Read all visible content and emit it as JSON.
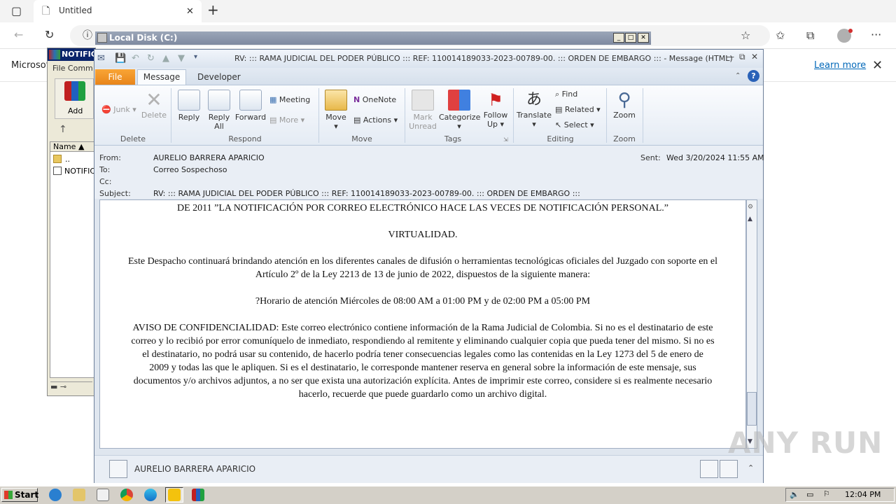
{
  "browser": {
    "tab_title": "Untitled",
    "banner_text": "Microsof",
    "learn_more": "Learn more"
  },
  "winrar": {
    "title": "NOTIFIC",
    "menu": "File  Comm",
    "add_label": "Add",
    "column_name": "Name",
    "rows": [
      "..",
      "NOTIFIC"
    ]
  },
  "explorer": {
    "title": "Local Disk (C:)"
  },
  "outlook": {
    "window_title": "RV: ::: RAMA JUDICIAL DEL PODER PÚBLICO ::: REF: 110014189033-2023-00789-00. ::: ORDEN DE EMBARGO ::: -  Message (HTML)",
    "tabs": {
      "file": "File",
      "message": "Message",
      "developer": "Developer"
    },
    "ribbon": {
      "delete_group": {
        "label": "Delete",
        "junk": "Junk",
        "delete": "Delete"
      },
      "respond_group": {
        "label": "Respond",
        "reply": "Reply",
        "reply_all_1": "Reply",
        "reply_all_2": "All",
        "forward": "Forward",
        "meeting": "Meeting",
        "more": "More"
      },
      "move_group": {
        "label": "Move",
        "move": "Move",
        "onenote": "OneNote",
        "actions": "Actions"
      },
      "tags_group": {
        "label": "Tags",
        "mark_1": "Mark",
        "mark_2": "Unread",
        "categorize": "Categorize",
        "follow_1": "Follow",
        "follow_2": "Up"
      },
      "editing_group": {
        "label": "Editing",
        "translate": "Translate",
        "find": "Find",
        "related": "Related",
        "select": "Select"
      },
      "zoom_group": {
        "label": "Zoom",
        "zoom": "Zoom"
      }
    },
    "header": {
      "from_label": "From:",
      "from_value": "AURELIO  BARRERA APARICIO",
      "to_label": "To:",
      "to_value": "Correo Sospechoso",
      "cc_label": "Cc:",
      "subject_label": "Subject:",
      "subject_value": "RV: ::: RAMA JUDICIAL DEL PODER PÚBLICO ::: REF: 110014189033-2023-00789-00. ::: ORDEN DE EMBARGO :::",
      "sent_label": "Sent:",
      "sent_value": "Wed 3/20/2024 11:55 AM"
    },
    "body": {
      "line1": "DE 2011 ”LA NOTIFICACIÓN POR CORREO ELECTRÓNICO HACE LAS VECES DE NOTIFICACIÓN PERSONAL.”",
      "line2": "VIRTUALIDAD.",
      "para1_l1": "Este Despacho continuará brindando atención en los diferentes canales de difusión o herramientas tecnológicas oficiales del Juzgado con soporte en el",
      "para1_l2": "Artículo 2º de la Ley 2213 de 13 de junio de 2022, dispuestos de la siguiente manera:",
      "hours": "?Horario de atención Miércoles de 08:00 AM a 01:00 PM y de 02:00 PM a 05:00 PM",
      "conf_l1": "AVISO DE CONFIDENCIALIDAD: Este correo electrónico contiene información de la Rama Judicial de Colombia. Si no es el destinatario de este",
      "conf_l2": "correo y lo recibió por error comuníquelo de inmediato, respondiendo al remitente y eliminando cualquier copia que pueda tener del mismo. Si no es",
      "conf_l3": "el destinatario, no podrá usar su contenido, de hacerlo podría tener consecuencias legales como las contenidas en la Ley 1273 del 5 de enero de",
      "conf_l4": "2009 y todas las que le apliquen. Si es el destinatario, le corresponde mantener reserva en general sobre la información de este mensaje, sus",
      "conf_l5": "documentos y/o archivos adjuntos, a no ser que exista una autorización explícita. Antes de imprimir este correo, considere si es realmente necesario",
      "conf_l6": "hacerlo, recuerde que puede guardarlo como un archivo digital."
    },
    "people_pane_name": "AURELIO  BARRERA APARICIO"
  },
  "taskbar": {
    "start": "Start",
    "clock": "12:04 PM"
  },
  "watermark": "ANY RUN"
}
